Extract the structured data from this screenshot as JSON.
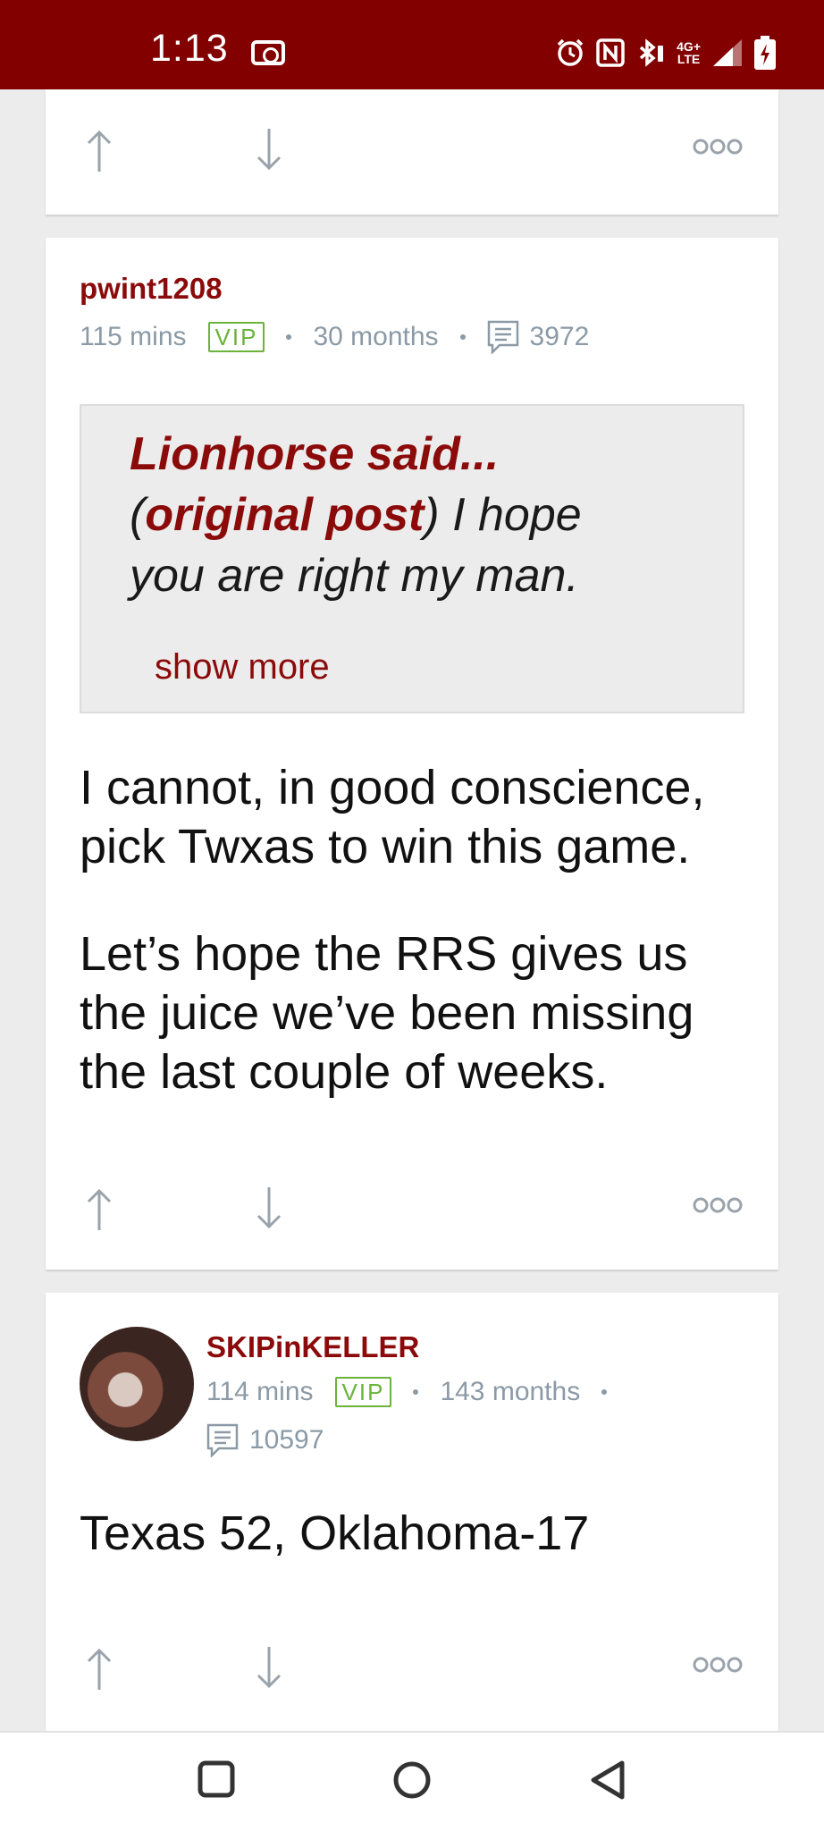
{
  "status_bar": {
    "time": "1:13",
    "network_top": "4G+",
    "network_bottom": "LTE",
    "icons": [
      "screen-record-icon",
      "alarm-icon",
      "nfc-icon",
      "bluetooth-icon",
      "signal-icon",
      "battery-charging-icon"
    ]
  },
  "colors": {
    "status_bar_bg": "#830000",
    "username": "#8b0a0a",
    "vip": "#6bb33b",
    "meta": "#8b9aa6"
  },
  "posts": [
    {
      "username": "pwint1208",
      "time": "115 mins",
      "badge": "VIP",
      "tenure": "30 months",
      "post_count": "3972",
      "quote": {
        "author_said": "Lionhorse said...",
        "link_label": "original post",
        "text": ") I hope you are right my man.",
        "show_more": "show more"
      },
      "paragraphs": [
        "I cannot, in good conscience, pick Twxas to win this game.",
        "Let’s hope the RRS gives us the juice we’ve been missing the last couple of weeks."
      ]
    },
    {
      "username": "SKIPinKELLER",
      "time": "114 mins",
      "badge": "VIP",
      "tenure": "143 months",
      "post_count": "10597",
      "paragraphs": [
        "Texas 52, Oklahoma-17"
      ]
    }
  ]
}
